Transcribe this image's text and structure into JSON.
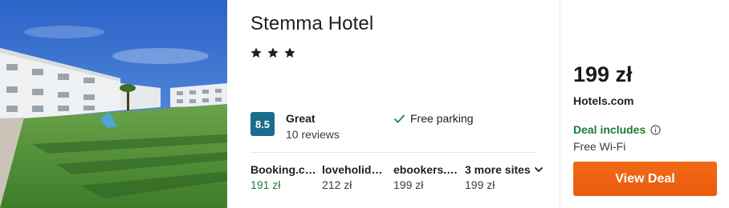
{
  "hotel": {
    "name": "Stemma Hotel",
    "star_count": 3
  },
  "rating": {
    "score": "8.5",
    "label": "Great",
    "reviews": "10 reviews"
  },
  "amenity": {
    "label": "Free parking",
    "icon": "check-icon"
  },
  "sites": [
    {
      "name": "Booking.com",
      "price": "191 zł",
      "highlight": true
    },
    {
      "name": "loveholidays",
      "price": "212 zł",
      "highlight": false
    },
    {
      "name": "ebookers.com",
      "price": "199 zł",
      "highlight": false
    }
  ],
  "more_sites": {
    "label": "3 more sites",
    "price": "199 zł",
    "icon": "chevron-down-icon"
  },
  "deal": {
    "price": "199 zł",
    "site": "Hotels.com",
    "includes_label": "Deal includes",
    "includes_icon": "info-icon",
    "includes_item": "Free Wi-Fi",
    "button_label": "View Deal"
  },
  "colors": {
    "rating_box": "#1b6d8e",
    "best_price": "#1e7b32",
    "deal_button": "#ec620f"
  }
}
